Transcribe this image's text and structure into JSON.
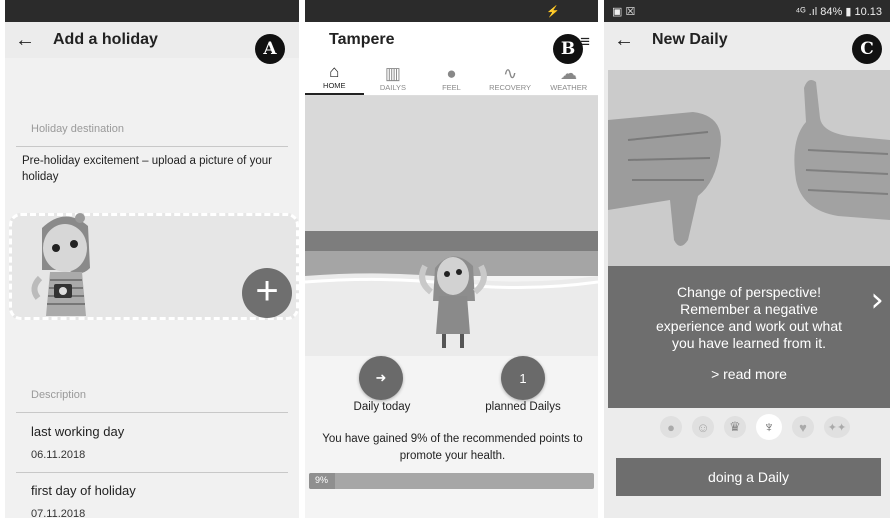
{
  "panel_a": {
    "badge": "A",
    "title": "Add a holiday",
    "destination_label": "Holiday destination",
    "destination_text": "Pre-holiday excitement – upload a picture of your holiday",
    "add_icon": "plus-icon",
    "description_label": "Description",
    "entries": [
      {
        "title": "last working day",
        "date": "06.11.2018"
      },
      {
        "title": "first day of holiday",
        "date": "07.11.2018"
      }
    ]
  },
  "panel_b": {
    "badge": "B",
    "status_icon": "⚡",
    "title": "Tampere",
    "tabs": [
      {
        "label": "HOME",
        "icon": "home-icon",
        "glyph": "⌂",
        "active": true
      },
      {
        "label": "DAILYS",
        "icon": "map-icon",
        "glyph": "▥",
        "active": false
      },
      {
        "label": "FEEL",
        "icon": "person-icon",
        "glyph": "●",
        "active": false
      },
      {
        "label": "RECOVERY",
        "icon": "pulse-icon",
        "glyph": "∿",
        "active": false
      },
      {
        "label": "WEATHER",
        "icon": "weather-icon",
        "glyph": "☁",
        "active": false
      }
    ],
    "daily_today_label": "Daily today",
    "daily_today_glyph": "➜",
    "planned_count": "1",
    "planned_label": "planned Dailys",
    "points_text": "You have gained 9% of the recommended points to promote your health.",
    "progress_label": "9%",
    "progress_value": 0.09
  },
  "panel_c": {
    "badge": "C",
    "status_right": "⁴ᴳ .ıl 84% ▮ 10.13",
    "title": "New Daily",
    "card_text": "Change of perspective! Remember a negative experience and work out what you have learned from it.",
    "read_more": "> read more",
    "action_label": "doing a Daily"
  }
}
